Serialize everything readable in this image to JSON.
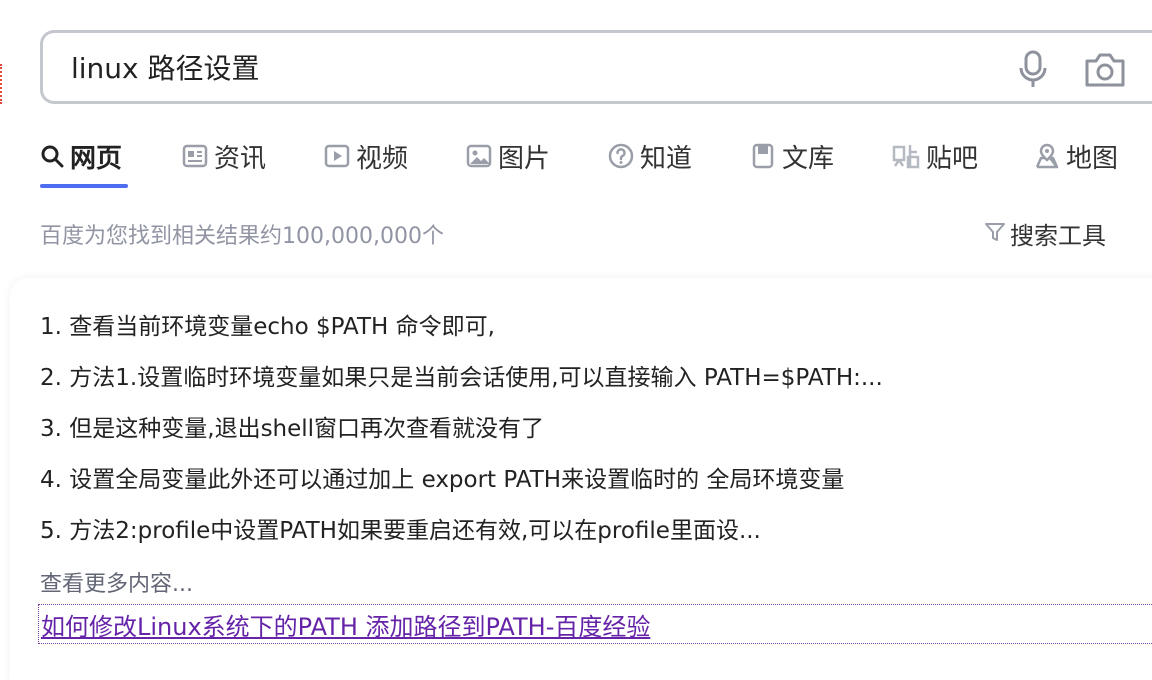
{
  "search": {
    "query": "linux 路径设置"
  },
  "tabs": [
    {
      "label": "网页",
      "icon": "search-icon",
      "active": true
    },
    {
      "label": "资讯",
      "icon": "news-icon"
    },
    {
      "label": "视频",
      "icon": "video-icon"
    },
    {
      "label": "图片",
      "icon": "image-icon"
    },
    {
      "label": "知道",
      "icon": "question-icon"
    },
    {
      "label": "文库",
      "icon": "document-icon"
    },
    {
      "label": "贴吧",
      "icon": "tieba-icon"
    },
    {
      "label": "地图",
      "icon": "map-icon"
    }
  ],
  "results": {
    "count_text": "百度为您找到相关结果约100,000,000个",
    "tools_label": "搜索工具"
  },
  "card": {
    "items": [
      "1. 查看当前环境变量echo $PATH 命令即可,",
      "2. 方法1.设置临时环境变量如果只是当前会话使用,可以直接输入 PATH=$PATH:...",
      "3. 但是这种变量,退出shell窗口再次查看就没有了",
      "4. 设置全局变量此外还可以通过加上 export PATH来设置临时的 全局环境变量",
      "5. 方法2:profile中设置PATH如果要重启还有效,可以在profile里面设..."
    ],
    "see_more": "查看更多内容...",
    "source_link": "如何修改Linux系统下的PATH 添加路径到PATH-百度经验"
  },
  "colors": {
    "accent": "#4e6ef2",
    "link_visited": "#6523a8",
    "muted": "#9195a3"
  }
}
